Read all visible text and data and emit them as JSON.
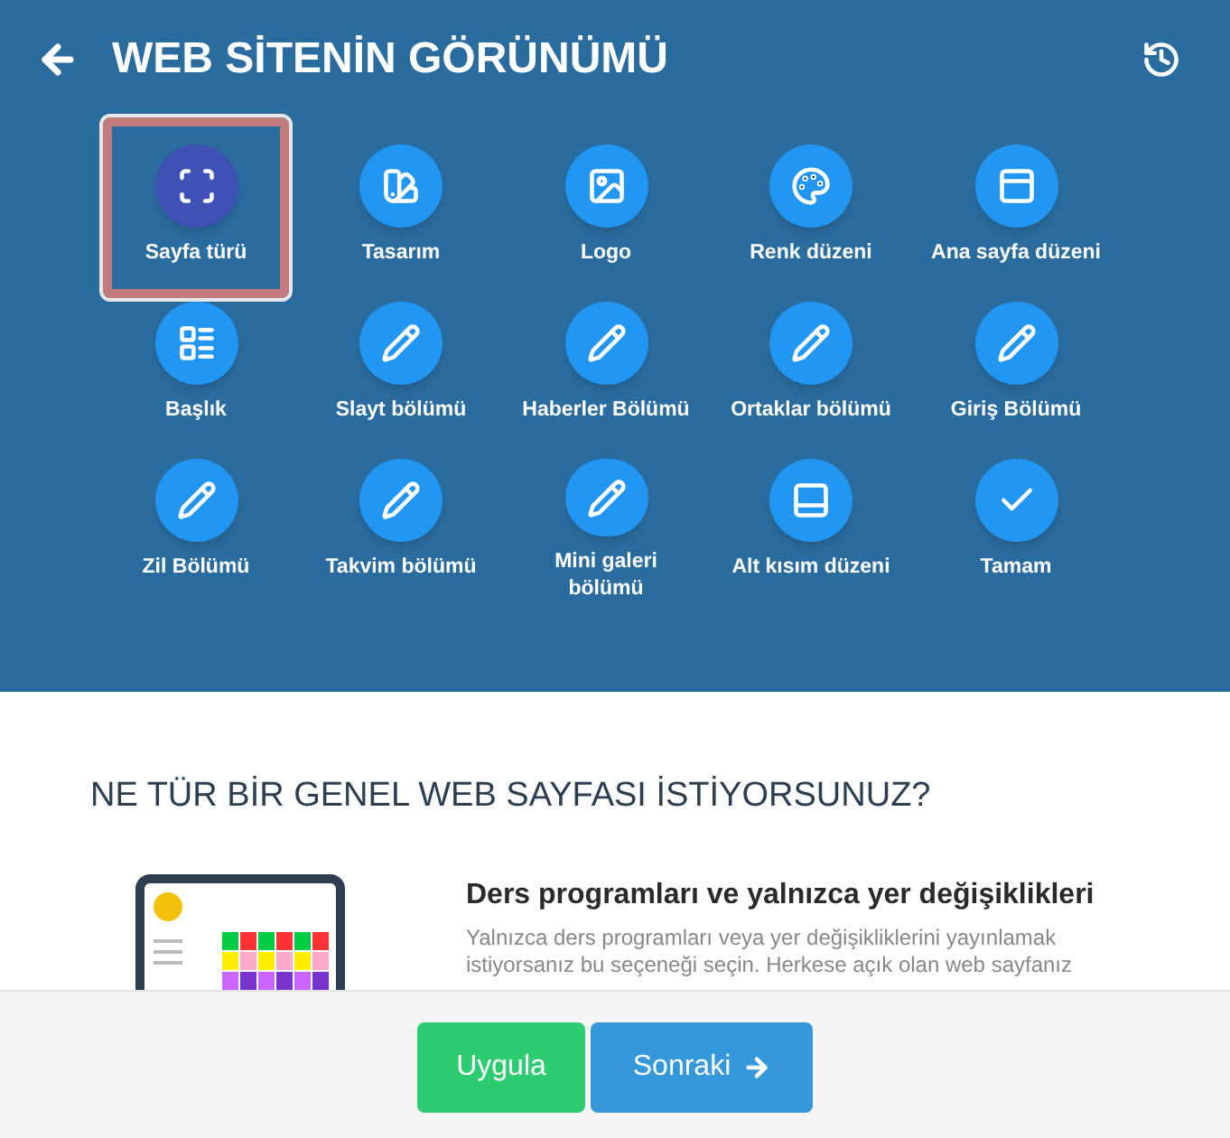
{
  "header": {
    "title": "WEB SİTENİN GÖRÜNÜMÜ"
  },
  "steps": [
    {
      "label": "Sayfa türü",
      "selected": true
    },
    {
      "label": "Tasarım",
      "selected": false
    },
    {
      "label": "Logo",
      "selected": false
    },
    {
      "label": "Renk düzeni",
      "selected": false
    },
    {
      "label": "Ana sayfa düzeni",
      "selected": false
    },
    {
      "label": "Başlık",
      "selected": false
    },
    {
      "label": "Slayt bölümü",
      "selected": false
    },
    {
      "label": "Haberler Bölümü",
      "selected": false
    },
    {
      "label": "Ortaklar bölümü",
      "selected": false
    },
    {
      "label": "Giriş Bölümü",
      "selected": false
    },
    {
      "label": "Zil Bölümü",
      "selected": false
    },
    {
      "label": "Takvim bölümü",
      "selected": false
    },
    {
      "label": "Mini galeri bölümü",
      "selected": false
    },
    {
      "label": "Alt kısım düzeni",
      "selected": false
    },
    {
      "label": "Tamam",
      "selected": false
    }
  ],
  "question": "NE TÜR BİR GENEL WEB SAYFASI İSTİYORSUNUZ?",
  "option": {
    "title": "Ders programları ve yalnızca yer değişiklikleri",
    "description": "Yalnızca ders programları veya yer değişikliklerini yayınlamak istiyorsanız bu seçeneği seçin. Herkese açık olan web sayfanız"
  },
  "footer": {
    "apply": "Uygula",
    "next": "Sonraki"
  }
}
